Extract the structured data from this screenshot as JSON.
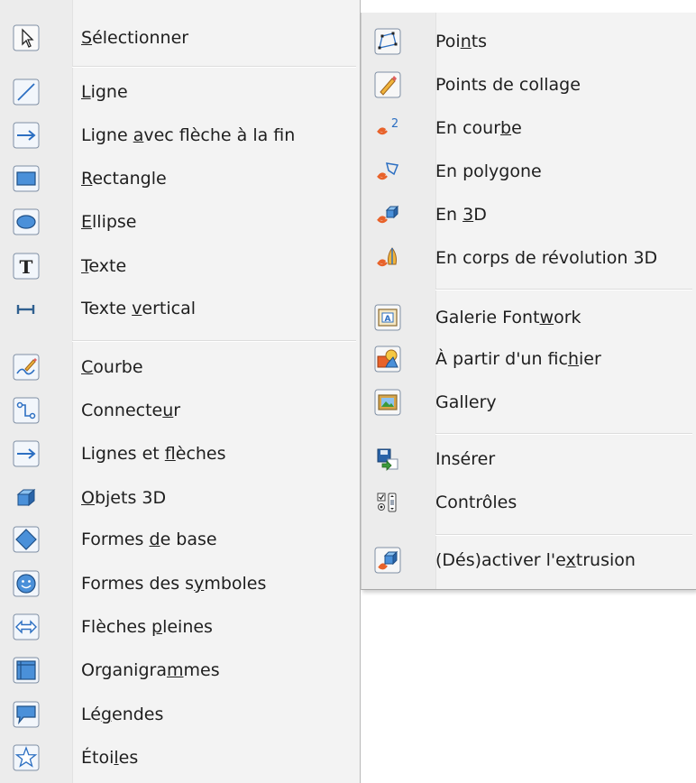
{
  "left_menu": {
    "items": [
      {
        "pre": "",
        "u": "S",
        "post": "électionner",
        "icon": "cursor-arrow-icon"
      },
      {
        "pre": "",
        "u": "L",
        "post": "igne",
        "icon": "line-icon"
      },
      {
        "pre": "Ligne ",
        "u": "a",
        "post": "vec flèche à la fin",
        "icon": "line-with-arrow-icon"
      },
      {
        "pre": "",
        "u": "R",
        "post": "ectangle",
        "icon": "rectangle-icon"
      },
      {
        "pre": "",
        "u": "E",
        "post": "llipse",
        "icon": "ellipse-icon"
      },
      {
        "pre": "",
        "u": "T",
        "post": "exte",
        "icon": "text-icon"
      },
      {
        "pre": "Texte ",
        "u": "v",
        "post": "ertical",
        "icon": "vertical-text-icon"
      },
      {
        "pre": "",
        "u": "C",
        "post": "ourbe",
        "icon": "curve-pencil-icon"
      },
      {
        "pre": "Connecte",
        "u": "u",
        "post": "r",
        "icon": "connector-icon"
      },
      {
        "pre": "Lignes et ",
        "u": "f",
        "post": "lèches",
        "icon": "lines-arrows-icon"
      },
      {
        "pre": "",
        "u": "O",
        "post": "bjets 3D",
        "icon": "cube-3d-icon"
      },
      {
        "pre": "Formes ",
        "u": "d",
        "post": "e base",
        "icon": "diamond-icon"
      },
      {
        "pre": "Formes des s",
        "u": "y",
        "post": "mboles",
        "icon": "smiley-icon"
      },
      {
        "pre": "Flèches ",
        "u": "p",
        "post": "leines",
        "icon": "double-arrow-icon"
      },
      {
        "pre": "Organigra",
        "u": "m",
        "post": "mes",
        "icon": "flowchart-icon"
      },
      {
        "pre": "Lé",
        "u": "g",
        "post": "endes",
        "icon": "callout-icon"
      },
      {
        "pre": "Étoi",
        "u": "l",
        "post": "es",
        "icon": "star-icon"
      }
    ]
  },
  "right_menu": {
    "items": [
      {
        "pre": "Poi",
        "u": "n",
        "post": "ts",
        "icon": "points-icon"
      },
      {
        "pre": "Points de collage",
        "u": "",
        "post": "",
        "icon": "glue-points-icon"
      },
      {
        "pre": "En cour",
        "u": "b",
        "post": "e",
        "icon": "to-curve-icon"
      },
      {
        "pre": "En polygone",
        "u": "",
        "post": "",
        "icon": "to-polygon-icon"
      },
      {
        "pre": "En ",
        "u": "3",
        "post": "D",
        "icon": "to-3d-icon"
      },
      {
        "pre": "En corps de révolution 3D",
        "u": "",
        "post": "",
        "icon": "to-3d-rotation-icon"
      },
      {
        "pre": "Galerie Font",
        "u": "w",
        "post": "ork",
        "icon": "fontwork-icon"
      },
      {
        "pre": "À partir d'un fic",
        "u": "h",
        "post": "ier",
        "icon": "from-file-icon"
      },
      {
        "pre": "Gallery",
        "u": "",
        "post": "",
        "icon": "gallery-icon"
      },
      {
        "pre": "Insérer",
        "u": "",
        "post": "",
        "icon": "insert-icon"
      },
      {
        "pre": "Contrôles",
        "u": "",
        "post": "",
        "icon": "controls-icon"
      },
      {
        "pre": "(Dés)activer l'e",
        "u": "x",
        "post": "trusion",
        "icon": "extrusion-toggle-icon"
      }
    ]
  }
}
